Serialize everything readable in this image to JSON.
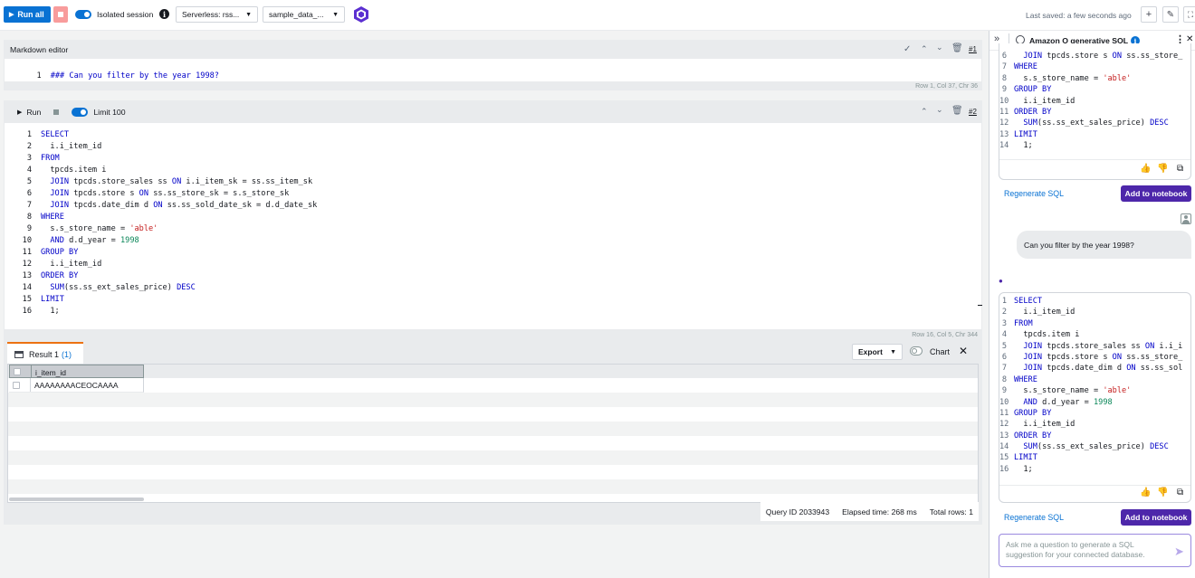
{
  "toolbar": {
    "run_all": "Run all",
    "isolated_session": "Isolated session",
    "serverless": "Serverless: rss...",
    "database": "sample_data_...",
    "last_saved": "Last saved: a few seconds ago"
  },
  "markdown_cell": {
    "title": "Markdown editor",
    "cell_number": "#1",
    "line_number": "1",
    "content": "### Can you filter by the year 1998?",
    "status": "Row 1,  Col 37,  Chr 36"
  },
  "sql_cell": {
    "run_label": "Run",
    "limit_label": "Limit 100",
    "cell_number": "#2",
    "status": "Row 16,  Col 5,  Chr 344",
    "lines": [
      "SELECT",
      "  i.i_item_id",
      "FROM",
      "  tpcds.item i",
      "  JOIN tpcds.store_sales ss ON i.i_item_sk = ss.ss_item_sk",
      "  JOIN tpcds.store s ON ss.ss_store_sk = s.s_store_sk",
      "  JOIN tpcds.date_dim d ON ss.ss_sold_date_sk = d.d_date_sk",
      "WHERE",
      "  s.s_store_name = 'able'",
      "  AND d.d_year = 1998",
      "GROUP BY",
      "  i.i_item_id",
      "ORDER BY",
      "  SUM(ss.ss_ext_sales_price) DESC",
      "LIMIT",
      "  1;"
    ]
  },
  "result": {
    "tab_label": "Result 1",
    "tab_count": "(1)",
    "export_label": "Export",
    "chart_label": "Chart",
    "column_header": "i_item_id",
    "rows": [
      "AAAAAAAACEOCAAAA"
    ],
    "query_id": "Query ID 2033943",
    "elapsed": "Elapsed time: 268 ms",
    "total_rows": "Total rows: 1"
  },
  "q_panel": {
    "title": "Amazon Q generative SQL",
    "first_suggestion": {
      "line_numbers": [
        "6",
        "7",
        "8",
        "9",
        "10",
        "11",
        "12",
        "13",
        "14"
      ],
      "lines": [
        "  JOIN tpcds.store s ON ss.ss_store_",
        "WHERE",
        "  s.s_store_name = 'able'",
        "GROUP BY",
        "  i.i_item_id",
        "ORDER BY",
        "  SUM(ss.ss_ext_sales_price) DESC",
        "LIMIT",
        "  1;"
      ]
    },
    "regenerate_label": "Regenerate SQL",
    "add_label": "Add to notebook",
    "user_question": "Can you filter by the year 1998?",
    "second_suggestion": {
      "line_numbers": [
        "1",
        "2",
        "3",
        "4",
        "5",
        "6",
        "7",
        "8",
        "9",
        "10",
        "11",
        "12",
        "13",
        "14",
        "15",
        "16"
      ],
      "lines": [
        "SELECT",
        "  i.i_item_id",
        "FROM",
        "  tpcds.item i",
        "  JOIN tpcds.store_sales ss ON i.i_i",
        "  JOIN tpcds.store s ON ss.ss_store_",
        "  JOIN tpcds.date_dim d ON ss.ss_sol",
        "WHERE",
        "  s.s_store_name = 'able'",
        "  AND d.d_year = 1998",
        "GROUP BY",
        "  i.i_item_id",
        "ORDER BY",
        "  SUM(ss.ss_ext_sales_price) DESC",
        "LIMIT",
        "  1;"
      ]
    },
    "input_placeholder": "Ask me a question to generate a SQL suggestion for your connected database."
  },
  "colors": {
    "accent": "#0972d3",
    "q_purple": "#4d27aa",
    "keyword": "#0000c8",
    "string": "#c41d1d",
    "number": "#098658"
  }
}
